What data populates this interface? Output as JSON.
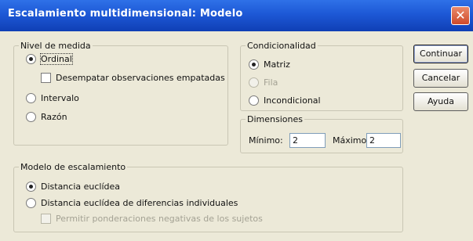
{
  "window": {
    "title": "Escalamiento multidimensional: Modelo",
    "close_glyph": "✕"
  },
  "nivel_medida": {
    "legend": "Nivel de medida",
    "options": [
      {
        "label": "Ordinal",
        "checked": true
      },
      {
        "label": "Intervalo",
        "checked": false
      },
      {
        "label": "Razón",
        "checked": false
      }
    ],
    "desempatar_label": "Desempatar observaciones empatadas"
  },
  "condicionalidad": {
    "legend": "Condicionalidad",
    "options": [
      {
        "label": "Matriz",
        "checked": true
      },
      {
        "label": "Fila",
        "checked": false,
        "disabled": true
      },
      {
        "label": "Incondicional",
        "checked": false
      }
    ]
  },
  "dimensiones": {
    "legend": "Dimensiones",
    "minimo_label": "Mínimo:",
    "minimo_value": "2",
    "maximo_label": "Máximo:",
    "maximo_value": "2"
  },
  "modelo": {
    "legend": "Modelo de escalamiento",
    "options": [
      {
        "label": "Distancia euclídea",
        "checked": true
      },
      {
        "label": "Distancia euclídea de diferencias individuales",
        "checked": false
      }
    ],
    "permitir_label": "Permitir ponderaciones negativas de los sujetos"
  },
  "buttons": {
    "continuar": "Continuar",
    "cancelar": "Cancelar",
    "ayuda": "Ayuda"
  }
}
